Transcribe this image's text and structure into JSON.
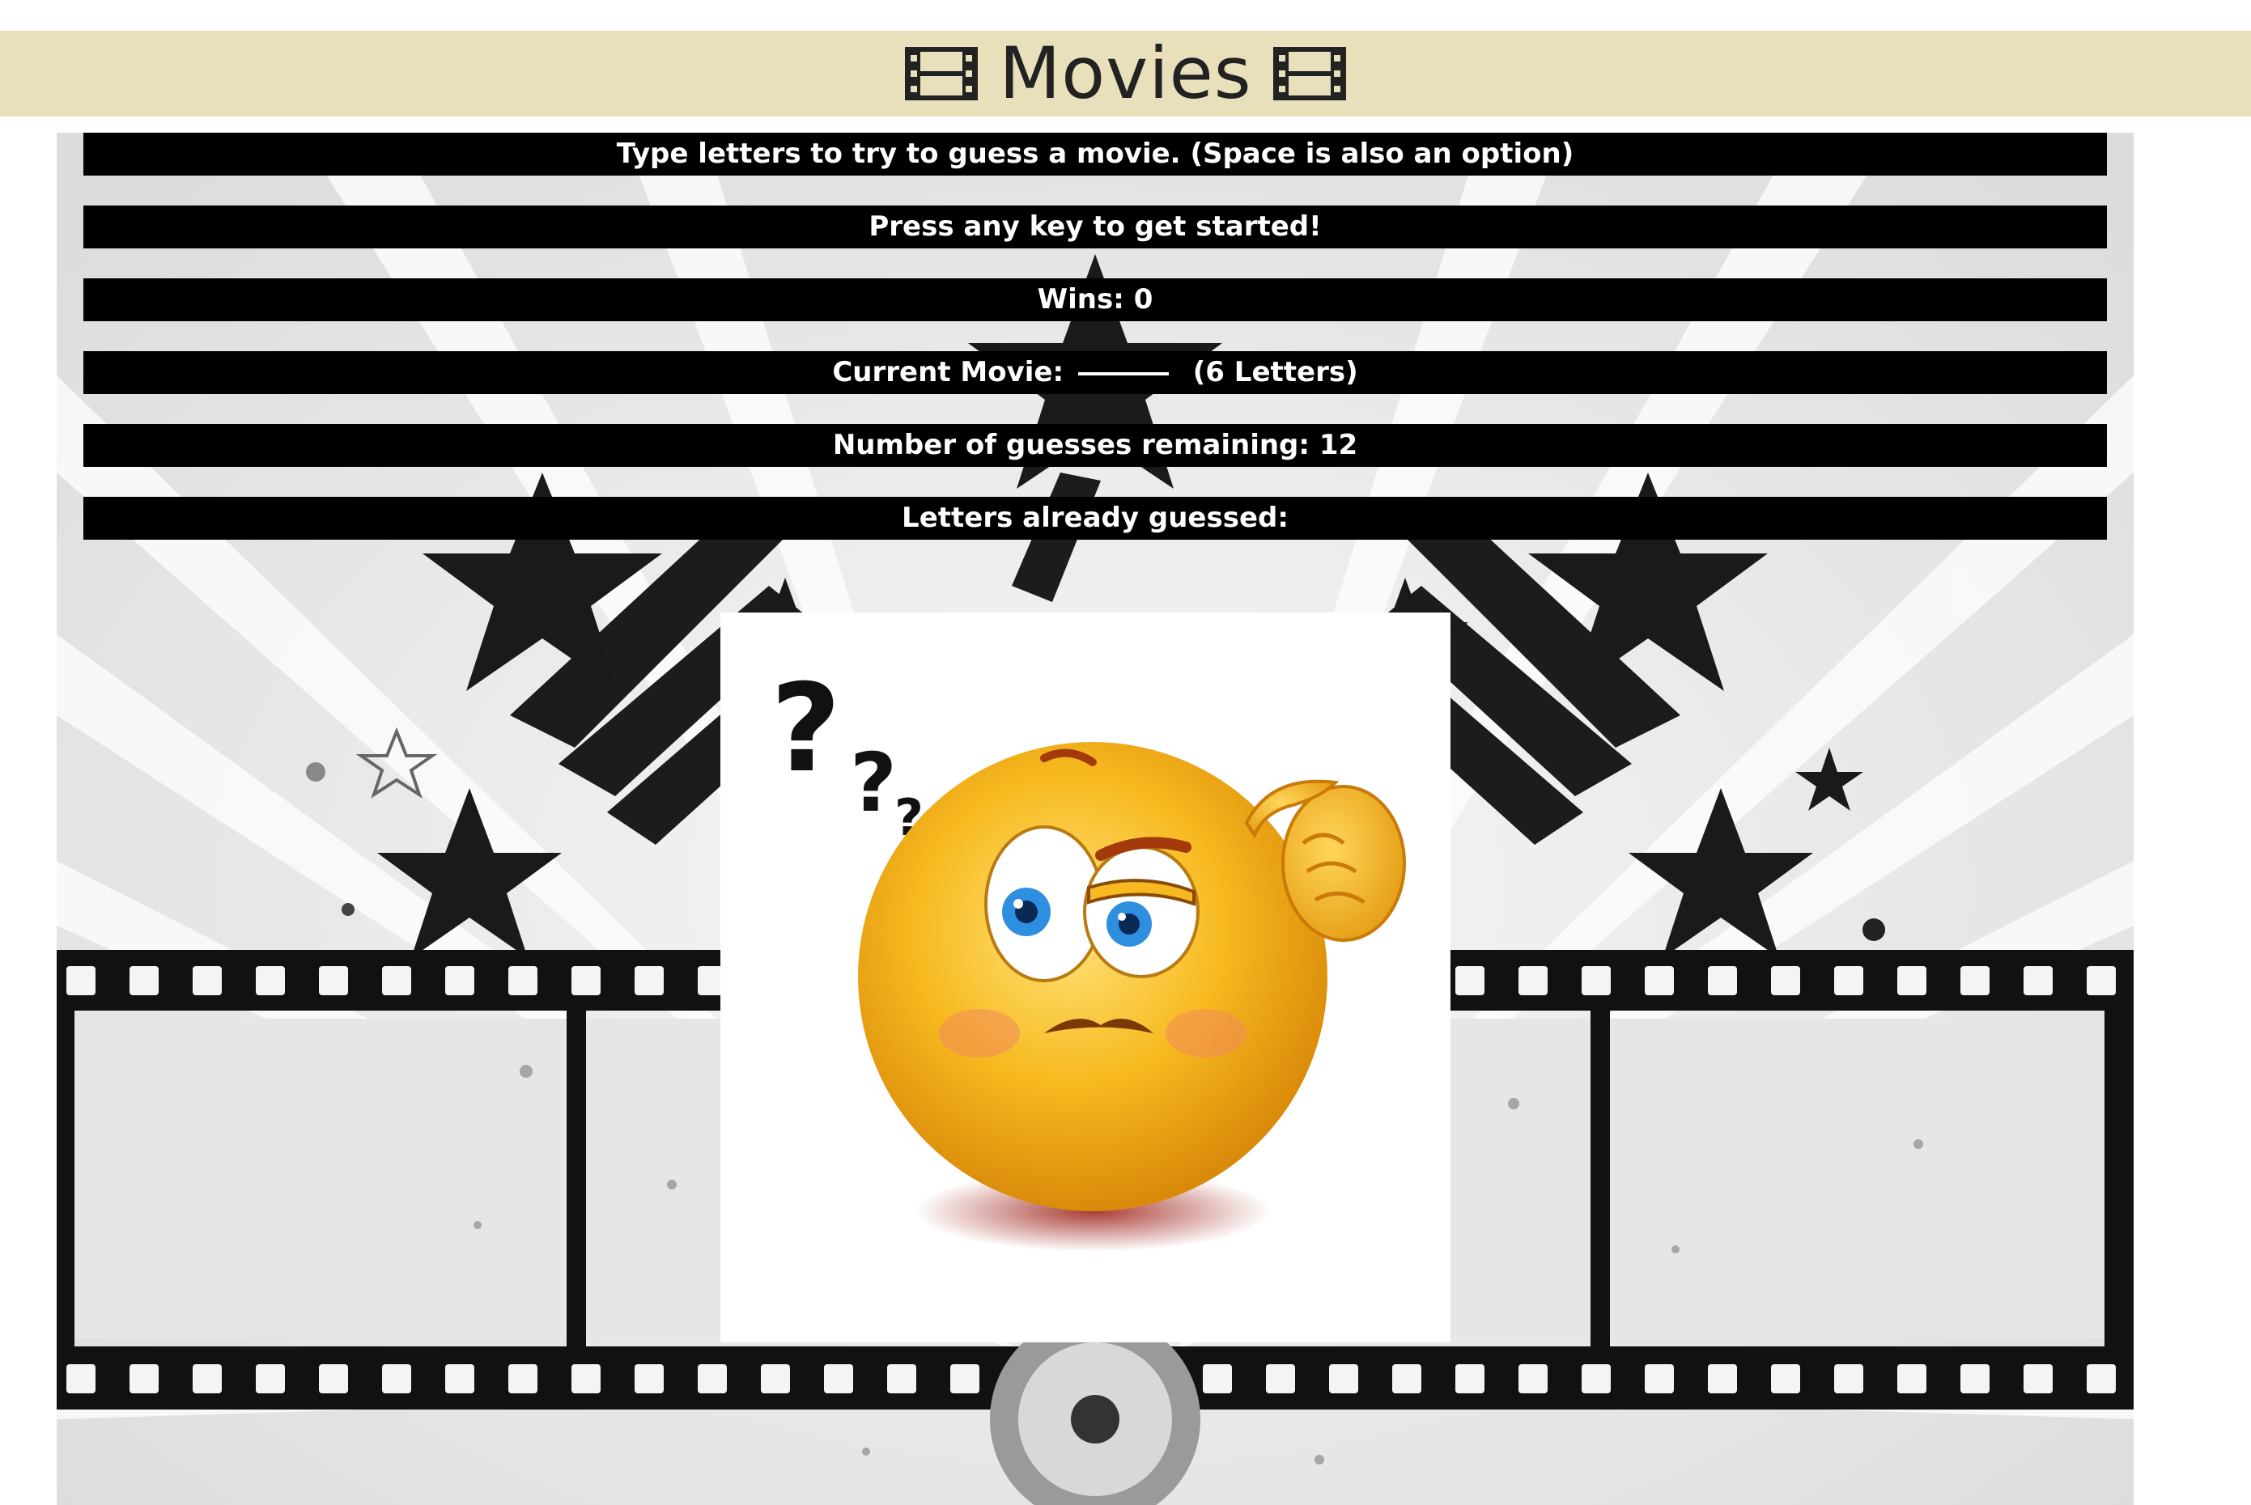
{
  "header": {
    "title": "Movies",
    "left_icon": "film-icon",
    "right_icon": "film-icon",
    "background_color": "#e8dfbb"
  },
  "game": {
    "instructions": "Type letters to try to guess a movie. (Space is also an option)",
    "prompt": "Press any key to get started!",
    "wins_label": "Wins:",
    "wins_value": "0",
    "current_movie_label": "Current Movie:",
    "current_movie_blank_count": 6,
    "current_movie_length_text": "(6 Letters)",
    "guesses_remaining_label": "Number of guesses remaining:",
    "guesses_remaining_value": "12",
    "letters_guessed_label": "Letters already guessed:",
    "letters_guessed_value": ""
  },
  "image": {
    "icon": "thinking-emoji-icon"
  },
  "background": {
    "icon": "film-strip-stars-background"
  }
}
